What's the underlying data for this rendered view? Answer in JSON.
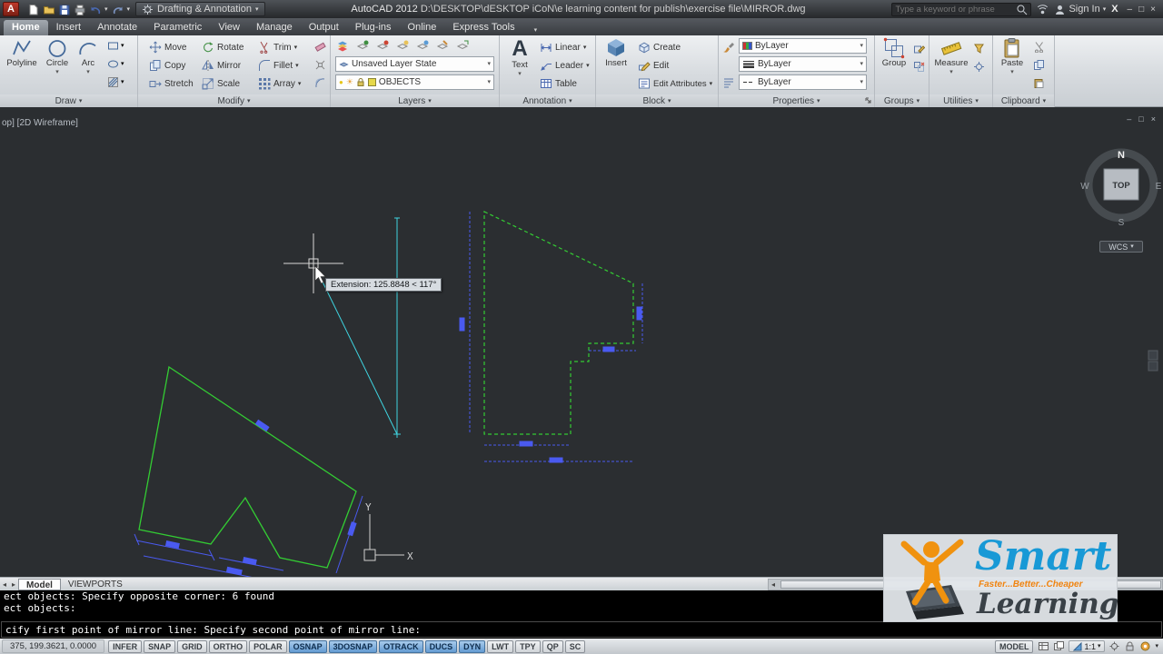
{
  "icons": {
    "caret": "▾",
    "arrow_left": "◂",
    "arrow_right": "▸",
    "minimize": "–",
    "maximize": "□",
    "close": "×",
    "exchange": "X",
    "app_logo": "A",
    "text_glyph": "A",
    "bulb": "●",
    "sun": "☀"
  },
  "titlebar": {
    "workspace": "Drafting & Annotation",
    "app": "AutoCAD 2012",
    "path": "D:\\DESKTOP\\dESKTOP iCoN\\e learning content for publish\\exercise file\\MIRROR.dwg",
    "search_placeholder": "Type a keyword or phrase",
    "sign_in": "Sign In"
  },
  "ribbon": {
    "tabs": [
      "Home",
      "Insert",
      "Annotate",
      "Parametric",
      "View",
      "Manage",
      "Output",
      "Plug-ins",
      "Online",
      "Express Tools"
    ],
    "active_tab": "Home",
    "panels": {
      "draw": {
        "title": "Draw",
        "polyline": "Polyline",
        "circle": "Circle",
        "arc": "Arc"
      },
      "modify": {
        "title": "Modify",
        "move": "Move",
        "copy": "Copy",
        "stretch": "Stretch",
        "rotate": "Rotate",
        "mirror": "Mirror",
        "scale": "Scale",
        "trim": "Trim",
        "fillet": "Fillet",
        "array": "Array"
      },
      "layers": {
        "title": "Layers",
        "layer_state": "Unsaved Layer State",
        "current_layer": "OBJECTS"
      },
      "annotation": {
        "title": "Annotation",
        "text": "Text",
        "linear": "Linear",
        "leader": "Leader",
        "table": "Table"
      },
      "block": {
        "title": "Block",
        "insert": "Insert",
        "create": "Create",
        "edit": "Edit",
        "edit_attributes": "Edit Attributes"
      },
      "properties": {
        "title": "Properties",
        "color": "ByLayer",
        "lineweight": "ByLayer",
        "linetype": "ByLayer"
      },
      "groups": {
        "title": "Groups",
        "group": "Group"
      },
      "utilities": {
        "title": "Utilities",
        "measure": "Measure"
      },
      "clipboard": {
        "title": "Clipboard",
        "paste": "Paste"
      }
    }
  },
  "canvas": {
    "viewport_label": "op] [2D Wireframe]",
    "tooltip": "Extension: 125.8848 < 117°",
    "viewcube": {
      "n": "N",
      "w": "W",
      "e": "E",
      "s": "S",
      "top": "TOP"
    },
    "wcs": "WCS",
    "ucs_x": "X",
    "ucs_y": "Y"
  },
  "layout_tabs": {
    "model": "Model",
    "viewports": "VIEWPORTS"
  },
  "command": {
    "line1": "ect objects: Specify opposite corner: 6 found",
    "line2": "ect objects:",
    "prompt": "cify first point of mirror line: Specify second point of mirror line:"
  },
  "statusbar": {
    "coordinates": "375, 199.3621, 0.0000",
    "toggles": [
      {
        "label": "INFER",
        "active": false
      },
      {
        "label": "SNAP",
        "active": false
      },
      {
        "label": "GRID",
        "active": false
      },
      {
        "label": "ORTHO",
        "active": false
      },
      {
        "label": "POLAR",
        "active": false
      },
      {
        "label": "OSNAP",
        "active": true
      },
      {
        "label": "3DOSNAP",
        "active": true
      },
      {
        "label": "OTRACK",
        "active": true
      },
      {
        "label": "DUCS",
        "active": true
      },
      {
        "label": "DYN",
        "active": true
      },
      {
        "label": "LWT",
        "active": false
      },
      {
        "label": "TPY",
        "active": false
      },
      {
        "label": "QP",
        "active": false
      },
      {
        "label": "SC",
        "active": false
      }
    ],
    "model_label": "MODEL",
    "scale": "1:1"
  },
  "watermark": {
    "brand_top": "Smart",
    "tagline": "Faster...Better...Cheaper",
    "brand_bottom": "Learning"
  }
}
